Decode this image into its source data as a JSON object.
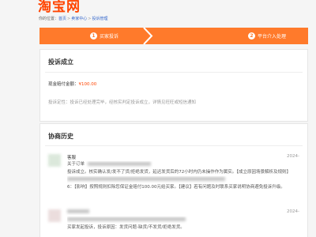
{
  "header": {
    "logo": "淘宝网"
  },
  "breadcrumb": {
    "prefix": "你的位置：",
    "items": [
      "首页",
      "卖家中心",
      "投诉管理"
    ],
    "separator": ">"
  },
  "steps": [
    {
      "num": "1",
      "label": "买家投诉"
    },
    {
      "num": "2",
      "label": "平台介入处理"
    }
  ],
  "complaint": {
    "title": "投诉成立",
    "amount_label": "现金赔付金额：",
    "amount_value": "¥100.00",
    "nature_label": "投诉定性：",
    "nature_text": "投诉已经处理完毕，经核实判定投诉成立，详情见旺旺或短信通知"
  },
  "history": {
    "title": "协商历史",
    "entries": [
      {
        "name": "客服",
        "time": "2024-",
        "lines": [
          "关于订单",
          "投诉成立。核实确认发/发不了货/拒绝发货，延迟发货后的72小时内仍未操作作为属实。【成立原因场景解析及规则】",
          "6：【影响】按照规则扣除您保证金赔付100.00元给买家。【建议】若有问题及时联系买家说明协商避免投诉升级。"
        ]
      },
      {
        "name": "",
        "time": "2024-",
        "lines": [
          "买家发起投诉，投诉原因：发货问题-缺货/不发货/拒绝发货。"
        ]
      }
    ]
  },
  "colors": {
    "accent": "#ff7a2b",
    "brand": "#ff4400",
    "link": "#3366cc"
  }
}
